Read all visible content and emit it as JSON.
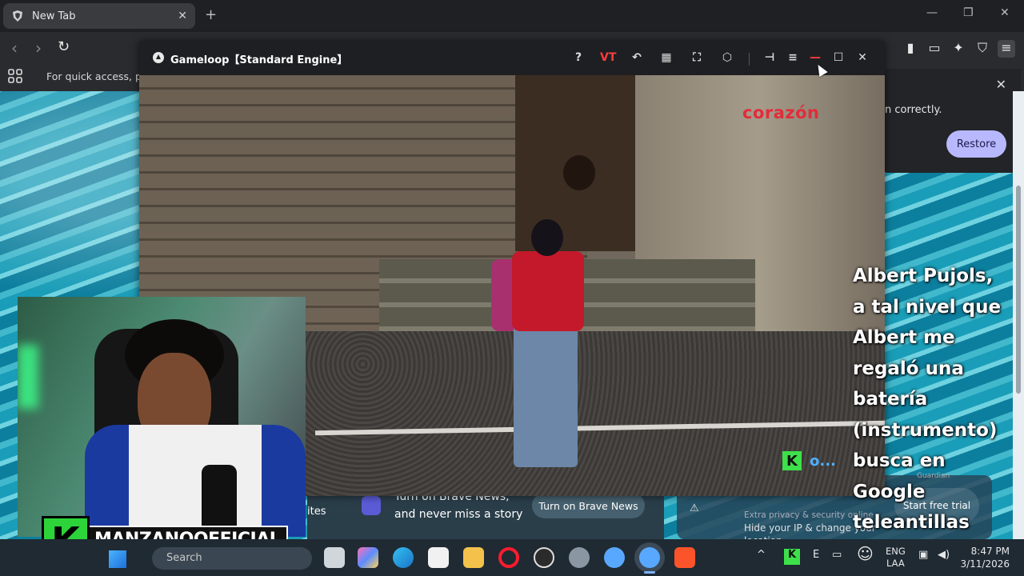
{
  "browser": {
    "tab": {
      "title": "New Tab"
    },
    "bookmarks_hint": "For quick access, plac",
    "restore_popup": {
      "text": "n correctly.",
      "restore_label": "Restore"
    }
  },
  "gameloop": {
    "title": "Gameloop【Standard Engine】",
    "vt_label": "VT",
    "watermark": "corazón",
    "k_overlay": {
      "badge": "K",
      "dots": "o..."
    }
  },
  "subtitles": [
    "Albert Pujols,",
    "a tal nivel que",
    "Albert me",
    "regaló una",
    "batería",
    "(instrumento)",
    "busca en",
    "Google",
    "teleantillas"
  ],
  "newtab_cards": {
    "fragment": "ites",
    "news_text_1": "Turn on Brave News,",
    "news_text_2": "and never miss a story",
    "news_button": "Turn on Brave News",
    "vpn_text_1": "Extra privacy & security online",
    "vpn_text_2": "Hide your IP & change your",
    "vpn_text_3": "location",
    "vpn_button": "Start free trial",
    "vpn_brand": "Guardian"
  },
  "streamer": {
    "badge": "K",
    "name": "MANZANOOFFICIAL"
  },
  "taskbar": {
    "search_placeholder": "Search",
    "lang_1": "ENG",
    "lang_2": "LAA",
    "time": "8:47 PM",
    "date": "3/11/2026"
  }
}
